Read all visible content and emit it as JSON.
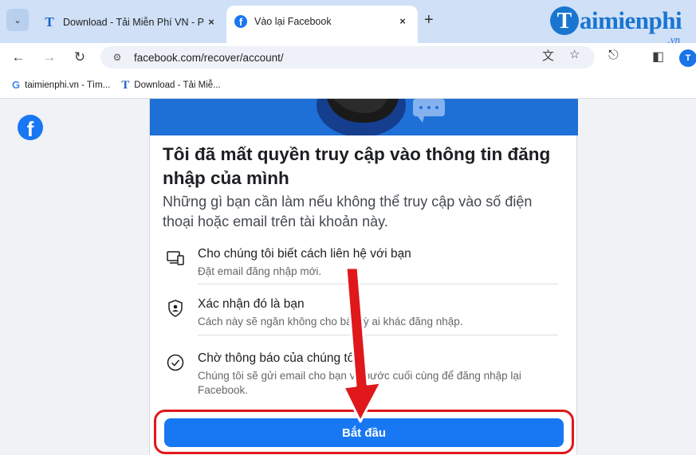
{
  "browser": {
    "tabs": [
      {
        "title": "Download - Tải Miễn Phí VN - P",
        "favicon": "taimienphi-t-icon",
        "active": false
      },
      {
        "title": "Vào lại Facebook",
        "favicon": "facebook-icon",
        "active": true
      }
    ],
    "new_tab_symbol": "+",
    "close_symbol": "×",
    "url": "facebook.com/recover/account/",
    "bookmarks": [
      {
        "label": "taimienphi.vn - Tìm...",
        "icon": "google-g-icon",
        "icon_glyph": "G"
      },
      {
        "label": "Download - Tải Miễ...",
        "icon": "taimienphi-t-icon",
        "icon_glyph": "T"
      }
    ],
    "profile_initial": "T"
  },
  "watermark": {
    "letter": "T",
    "text": "aimienphi",
    "suffix": ".vn"
  },
  "page": {
    "heading": "Tôi đã mất quyền truy cập vào thông tin đăng nhập của mình",
    "subtext": "Những gì bạn cần làm nếu không thể truy cập vào số điện thoại hoặc email trên tài khoản này.",
    "steps": [
      {
        "title": "Cho chúng tôi biết cách liên hệ với bạn",
        "desc": "Đặt email đăng nhập mới.",
        "icon": "devices-icon"
      },
      {
        "title": "Xác nhận đó là bạn",
        "desc": "Cách này sẽ ngăn không cho bất kỳ ai khác đăng nhập.",
        "icon": "shield-user-icon"
      },
      {
        "title": "Chờ thông báo của chúng tôi",
        "desc": "Chúng tôi sẽ gửi email cho bạn về bước cuối cùng để đăng nhập lại Facebook.",
        "icon": "check-circle-icon"
      }
    ],
    "cta_label": "Bắt đầu"
  },
  "colors": {
    "facebook_blue": "#1877f2",
    "annotation_red": "#e0171b",
    "tabstrip": "#cfe0f7"
  }
}
